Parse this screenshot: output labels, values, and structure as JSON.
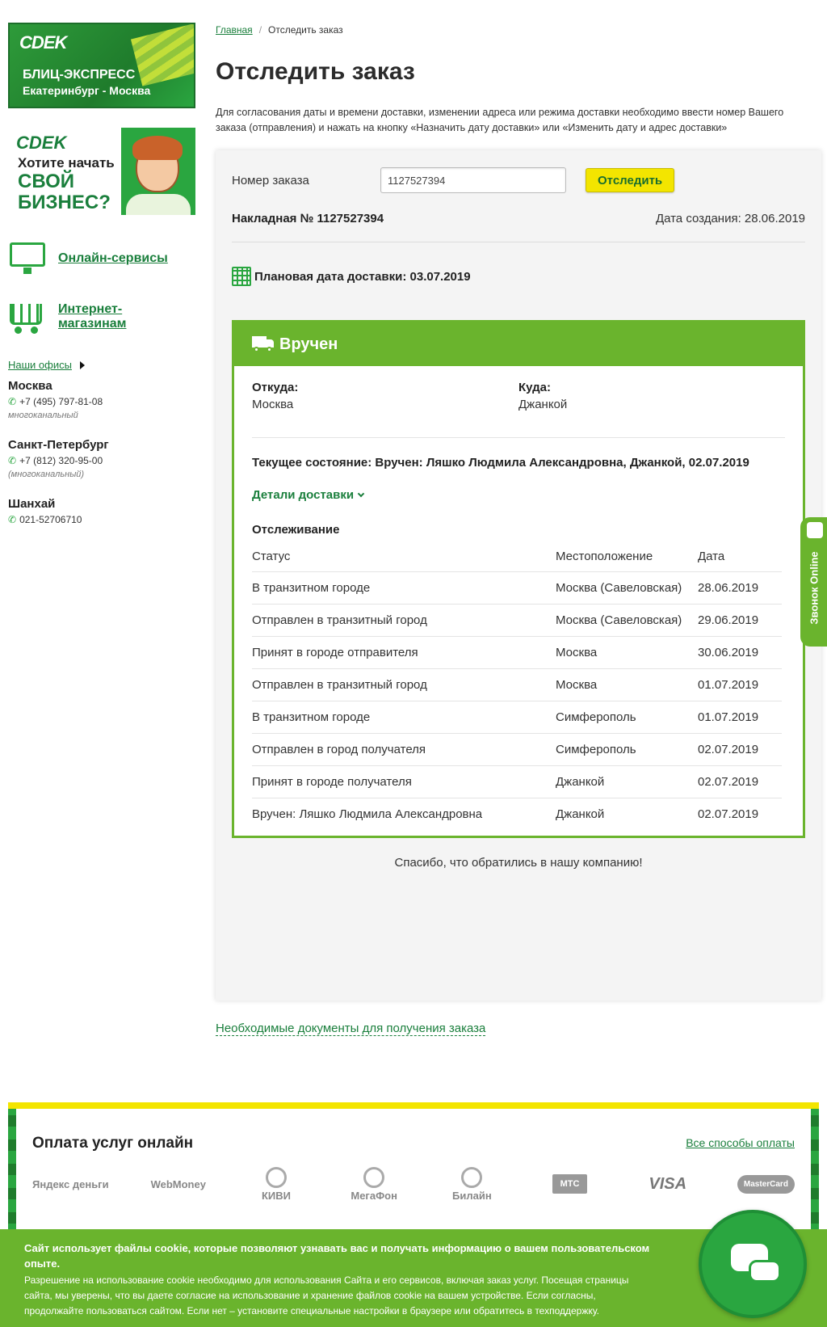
{
  "sidebar": {
    "banner1": {
      "logo": "CDEK",
      "line1": "БЛИЦ-ЭКСПРЕСС",
      "line2": "Екатеринбург - Москва"
    },
    "banner2": {
      "logo": "CDEK",
      "line1": "Хотите начать",
      "line2": "СВОЙ",
      "line3": "БИЗНЕС?"
    },
    "services": [
      {
        "label": "Онлайн-сервисы"
      },
      {
        "label": "Интернет-магазинам"
      }
    ],
    "offices_link": "Наши офисы",
    "cities": [
      {
        "name": "Москва",
        "phone": "+7 (495) 797-81-08",
        "note": "многоканальный"
      },
      {
        "name": "Санкт-Петербург",
        "phone": "+7 (812) 320-95-00",
        "note": "(многоканальный)"
      },
      {
        "name": "Шанхай",
        "phone": "021-52706710",
        "note": ""
      }
    ]
  },
  "breadcrumb": {
    "home": "Главная",
    "current": "Отследить заказ"
  },
  "page_title": "Отследить заказ",
  "intro": "Для согласования даты и времени доставки, изменении адреса или режима доставки необходимо ввести номер Вашего заказа (отправления) и нажать на кнопку «Назначить дату доставки» или «Изменить дату и адрес доставки»",
  "search": {
    "label": "Номер заказа",
    "value": "1127527394",
    "button": "Отследить"
  },
  "invoice": {
    "number": "Накладная № 1127527394",
    "created": "Дата создания: 28.06.2019"
  },
  "planned": "Плановая дата доставки: 03.07.2019",
  "status": {
    "title": "Вручен",
    "from_label": "Откуда:",
    "from": "Москва",
    "to_label": "Куда:",
    "to": "Джанкой",
    "current": "Текущее состояние: Вручен: Ляшко Людмила Александровна, Джанкой, 02.07.2019",
    "details": "Детали доставки",
    "tracking_title": "Отслеживание",
    "columns": [
      "Статус",
      "Местоположение",
      "Дата"
    ],
    "rows": [
      {
        "status": "В транзитном городе",
        "location": "Москва (Савеловская)",
        "date": "28.06.2019"
      },
      {
        "status": "Отправлен в транзитный город",
        "location": "Москва (Савеловская)",
        "date": "29.06.2019"
      },
      {
        "status": "Принят в городе отправителя",
        "location": "Москва",
        "date": "30.06.2019"
      },
      {
        "status": "Отправлен в транзитный город",
        "location": "Москва",
        "date": "01.07.2019"
      },
      {
        "status": "В транзитном городе",
        "location": "Симферополь",
        "date": "01.07.2019"
      },
      {
        "status": "Отправлен в город получателя",
        "location": "Симферополь",
        "date": "02.07.2019"
      },
      {
        "status": "Принят в городе получателя",
        "location": "Джанкой",
        "date": "02.07.2019"
      },
      {
        "status": "Вручен: Ляшко Людмила Александровна",
        "location": "Джанкой",
        "date": "02.07.2019"
      }
    ],
    "thanks": "Спасибо, что обратились в нашу компанию!"
  },
  "docs_link": "Необходимые документы для получения заказа",
  "call_tab": "Звонок Online",
  "payment": {
    "title": "Оплата услуг онлайн",
    "all_link": "Все способы оплаты",
    "logos": [
      "Яндекс деньги",
      "WebMoney",
      "КИВИ",
      "МегаФон",
      "Билайн",
      "МТС",
      "VISA",
      "MasterCard"
    ]
  },
  "cookie": {
    "heading": "Сайт использует файлы cookie, которые позволяют узнавать вас и получать информацию о вашем пользовательском опыте.",
    "text": "Разрешение на использование cookie необходимо для использования Сайта и его сервисов, включая заказ услуг. Посещая страницы сайта, мы уверены, что вы даете согласие на использование и хранение файлов cookie на вашем устройстве. Если согласны, продолжайте пользоваться сайтом. Если нет – установите специальные настройки в браузере или обратитесь в техподдержку."
  },
  "colors": {
    "brand_green": "#1a7f3c",
    "status_green": "#6ab42d",
    "button_yellow": "#f3e500"
  }
}
